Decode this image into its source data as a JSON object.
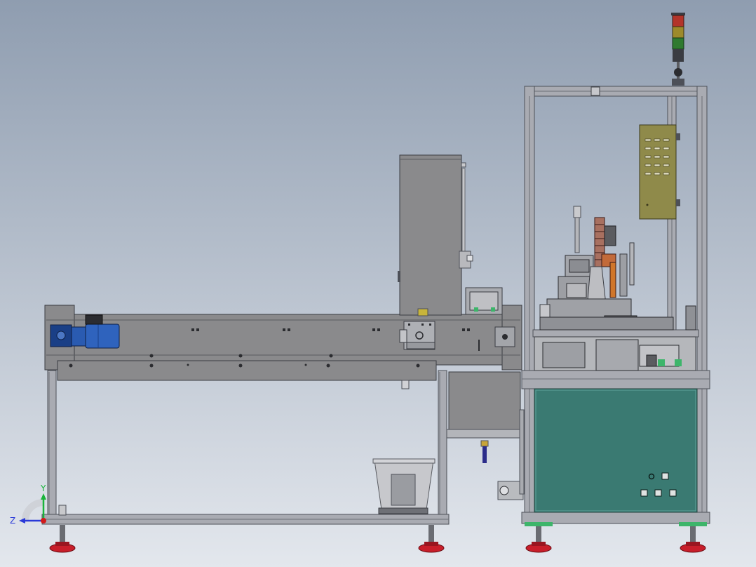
{
  "viewport": {
    "background_top": "#8f9db0",
    "background_bottom": "#e3e7ed"
  },
  "colors": {
    "frame": "#a9abb2",
    "frame_dark": "#4d5058",
    "conveyor": "#8a8a8c",
    "conveyor_dark": "#5b5c60",
    "panel_teal": "#3a7a72",
    "motor_blue": "#1f4fa3",
    "foot_red": "#c81e2a",
    "rail_green": "#3db56a",
    "control_box": "#8f8a4a",
    "light_red": "#b3342a",
    "light_yellow": "#9d8a2a",
    "light_green": "#2f7a2f"
  },
  "triad": {
    "y_label": "Y",
    "z_label": "Z",
    "y_color": "#18b43a",
    "z_color": "#2a3ad8",
    "x_color": "#d21a1a"
  }
}
